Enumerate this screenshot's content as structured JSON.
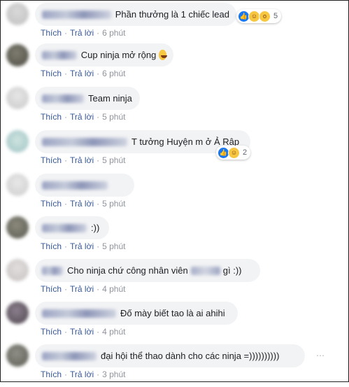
{
  "actions": {
    "like_label": "Thích",
    "reply_label": "Trả lời",
    "separator": "·"
  },
  "comments": [
    {
      "text": "Phần thưởng là 1 chiếc lead",
      "time": "6 phút",
      "reaction_count": "5"
    },
    {
      "text": "Cup ninja mở rộng",
      "time": "6 phút"
    },
    {
      "text": "Team ninja",
      "time": "5 phút"
    },
    {
      "text": "T tưởng Huyện m ở Ả Rập",
      "time": "5 phút",
      "reaction_count": "2"
    },
    {
      "text": "",
      "time": "5 phút"
    },
    {
      "text": ":))",
      "time": "5 phút"
    },
    {
      "text_before": "Cho ninja chứ công nhân viên",
      "text_after": "gì :))",
      "time": "4 phút"
    },
    {
      "text": "Đố mày biết tao là ai ahihi",
      "time": "4 phút"
    },
    {
      "text": "đại hội thể thao dành cho các ninja =))))))))))",
      "time": "3 phút"
    }
  ],
  "icons": {
    "like": "like-reaction-icon",
    "haha": "haha-reaction-icon",
    "wow": "wow-reaction-icon",
    "laughing_emoji": "laughing-emoji-icon",
    "more": "more-options-icon"
  },
  "colors": {
    "bubble": "#f2f3f5",
    "link": "#385898",
    "meta": "#90949c",
    "like": "#1877f2",
    "emoji": "#f7c741"
  }
}
